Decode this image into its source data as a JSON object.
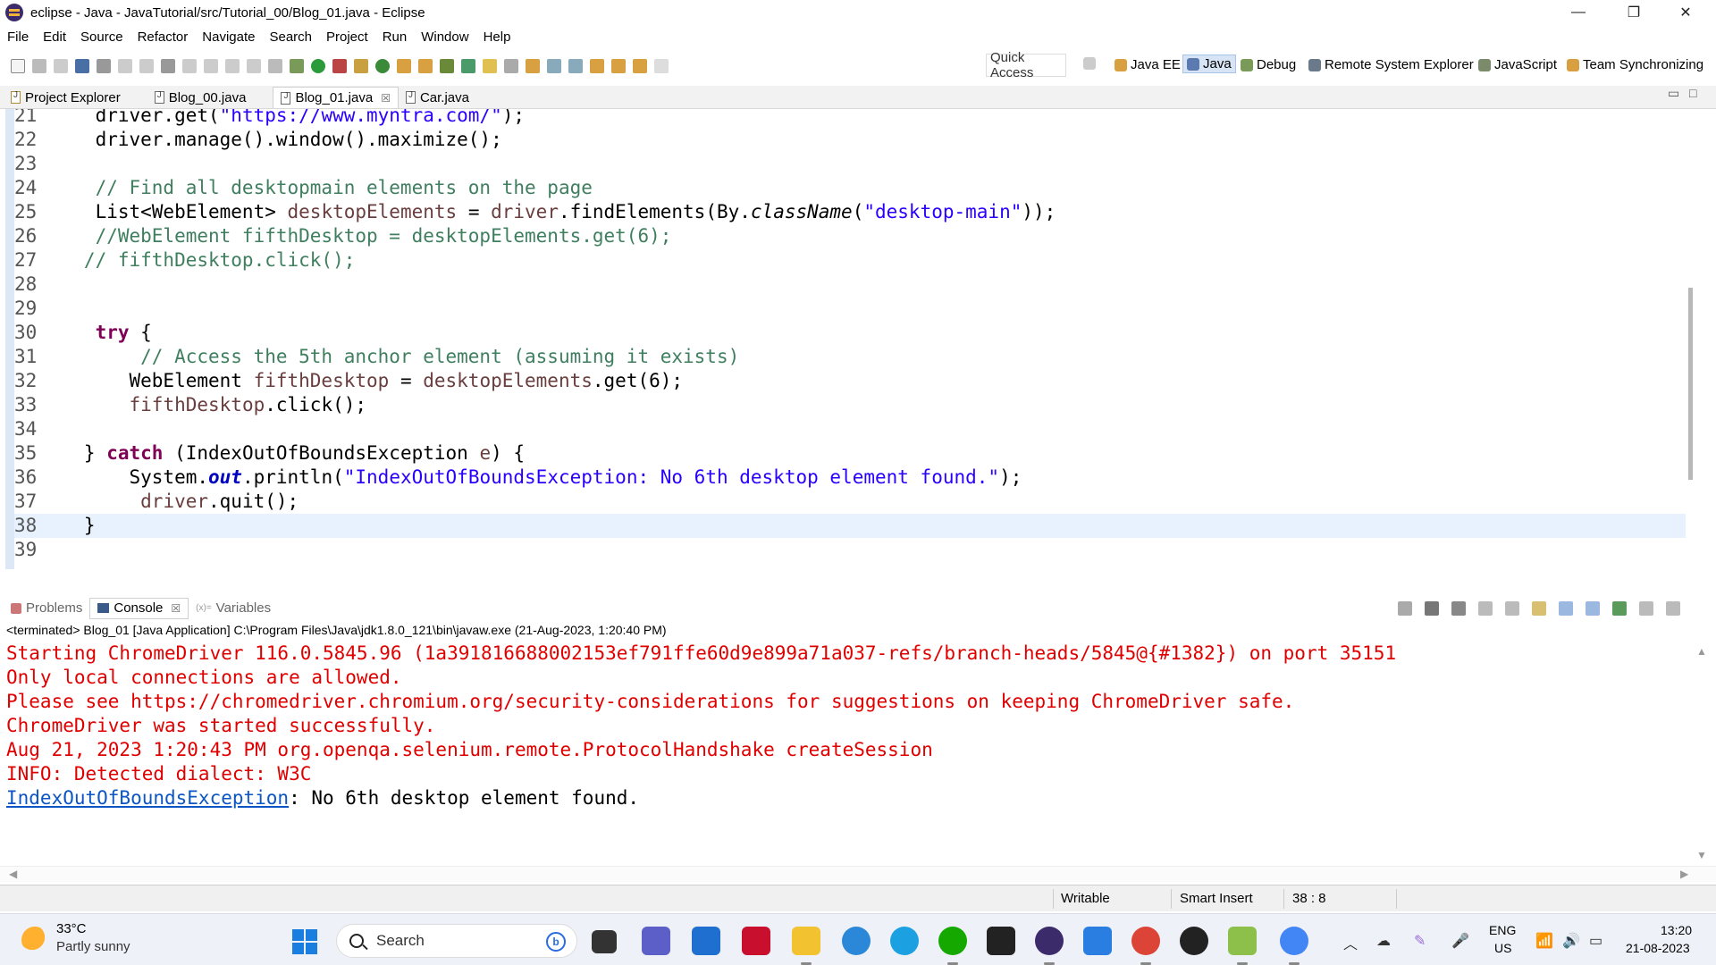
{
  "window": {
    "title": "eclipse - Java - JavaTutorial/src/Tutorial_00/Blog_01.java - Eclipse",
    "minimize": "—",
    "restore": "❐",
    "close": "✕"
  },
  "menu": [
    "File",
    "Edit",
    "Source",
    "Refactor",
    "Navigate",
    "Search",
    "Project",
    "Run",
    "Window",
    "Help"
  ],
  "toolbar": {
    "quick_access": "Quick Access",
    "perspectives": [
      "Java EE",
      "Java",
      "Debug",
      "Remote System Explorer",
      "JavaScript",
      "Team Synchronizing"
    ],
    "active_perspective": "Java"
  },
  "tabs": {
    "project_explorer": "Project Explorer",
    "files": [
      "Blog_00.java",
      "Blog_01.java",
      "Car.java"
    ],
    "active": "Blog_01.java",
    "close_glyph": "☒"
  },
  "editor": {
    "lines": [
      {
        "n": "21",
        "code": "    driver.get(\"https://www.myntra.com/\");"
      },
      {
        "n": "22",
        "code": "    driver.manage().window().maximize();"
      },
      {
        "n": "23",
        "code": ""
      },
      {
        "n": "24",
        "code": "    // Find all desktopmain elements on the page"
      },
      {
        "n": "25",
        "code": "    List<WebElement> desktopElements = driver.findElements(By.className(\"desktop-main\"));"
      },
      {
        "n": "26",
        "code": "    //WebElement fifthDesktop = desktopElements.get(6);"
      },
      {
        "n": "27",
        "code": "   // fifthDesktop.click();"
      },
      {
        "n": "28",
        "code": ""
      },
      {
        "n": "29",
        "code": ""
      },
      {
        "n": "30",
        "code": "    try {"
      },
      {
        "n": "31",
        "code": "        // Access the 5th anchor element (assuming it exists)"
      },
      {
        "n": "32",
        "code": "       WebElement fifthDesktop = desktopElements.get(6);"
      },
      {
        "n": "33",
        "code": "       fifthDesktop.click();"
      },
      {
        "n": "34",
        "code": ""
      },
      {
        "n": "35",
        "code": "   } catch (IndexOutOfBoundsException e) {"
      },
      {
        "n": "36",
        "code": "       System.out.println(\"IndexOutOfBoundsException: No 6th desktop element found.\");"
      },
      {
        "n": "37",
        "code": "        driver.quit();"
      },
      {
        "n": "38",
        "code": "   }"
      },
      {
        "n": "39",
        "code": ""
      }
    ],
    "highlighted_line": "38"
  },
  "console": {
    "tabs": [
      "Problems",
      "Console",
      "Variables"
    ],
    "active_tab": "Console",
    "status": "<terminated> Blog_01 [Java Application] C:\\Program Files\\Java\\jdk1.8.0_121\\bin\\javaw.exe (21-Aug-2023, 1:20:40 PM)",
    "error_lines": [
      "Starting ChromeDriver 116.0.5845.96 (1a391816688002153ef791ffe60d9e899a71a037-refs/branch-heads/5845@{#1382}) on port 35151",
      "Only local connections are allowed.",
      "Please see https://chromedriver.chromium.org/security-considerations for suggestions on keeping ChromeDriver safe.",
      "ChromeDriver was started successfully.",
      "Aug 21, 2023 1:20:43 PM org.openqa.selenium.remote.ProtocolHandshake createSession",
      "INFO: Detected dialect: W3C"
    ],
    "exception_link": "IndexOutOfBoundsException",
    "exception_message": ": No 6th desktop element found."
  },
  "statusbar": {
    "writable": "Writable",
    "insert_mode": "Smart Insert",
    "position": "38 : 8"
  },
  "taskbar": {
    "weather_temp": "33°C",
    "weather_desc": "Partly sunny",
    "search_placeholder": "Search",
    "bing": "b",
    "lang": "ENG",
    "region": "US",
    "time": "13:20",
    "date": "21-08-2023"
  },
  "colors": {
    "keyword": "#7f0055",
    "comment": "#3f7f5f",
    "string": "#2a00ff",
    "console_error": "#e00000",
    "link": "#0b55c4"
  }
}
